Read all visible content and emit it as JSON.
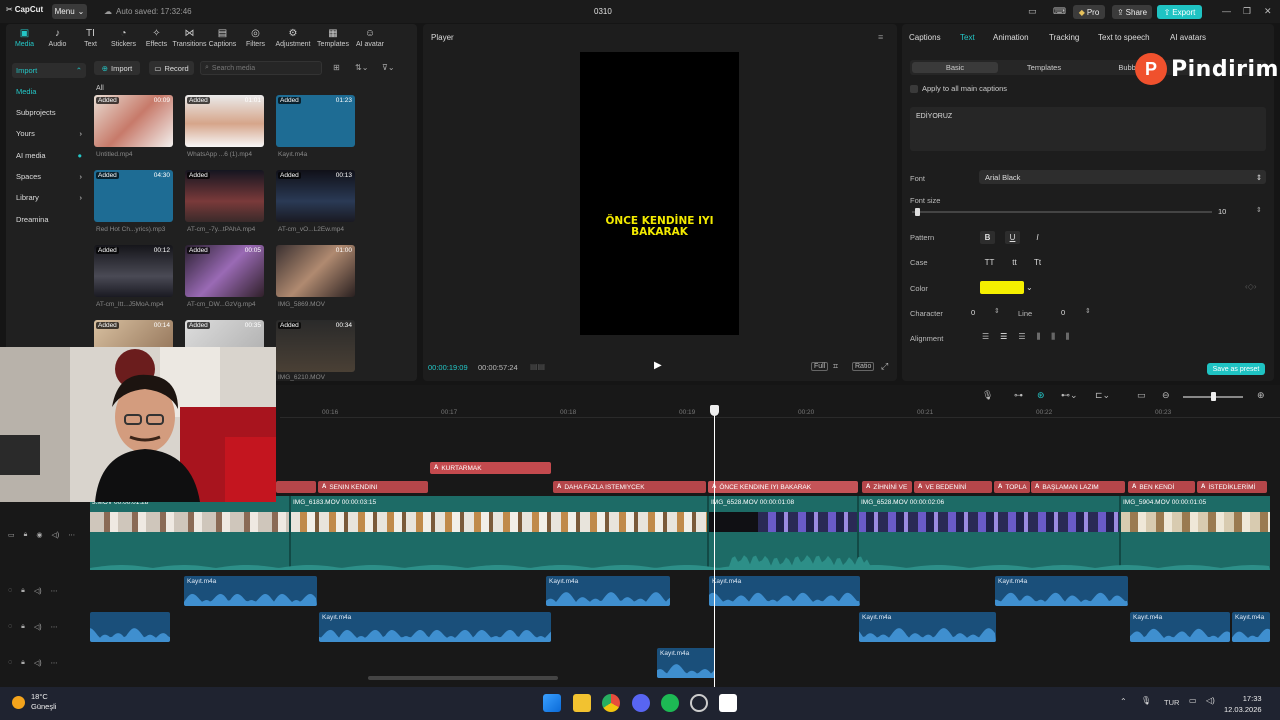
{
  "titlebar": {
    "app_name": "CapCut",
    "menu_label": "Menu",
    "autosave": "Auto saved: 17:32:46",
    "project_title": "0310",
    "pro_label": "Pro",
    "share_label": "Share",
    "export_label": "Export"
  },
  "toolbar": {
    "tools": [
      "Media",
      "Audio",
      "Text",
      "Stickers",
      "Effects",
      "Transitions",
      "Captions",
      "Filters",
      "Adjustment",
      "Templates",
      "AI avatar"
    ]
  },
  "sidebar": {
    "items": [
      "Import",
      "Media",
      "Subprojects",
      "Yours",
      "AI media",
      "Spaces",
      "Library",
      "Dreamina"
    ]
  },
  "media": {
    "import_label": "Import",
    "record_label": "Record",
    "search_placeholder": "Search media",
    "all_label": "All",
    "added_label": "Added",
    "items": [
      {
        "name": "Untitled.mp4",
        "duration": "00:09"
      },
      {
        "name": "WhatsApp ...6 (1).mp4",
        "duration": "01:01"
      },
      {
        "name": "Kayıt.m4a",
        "duration": "01:23"
      },
      {
        "name": "Red Hot Ch...yrics).mp3",
        "duration": "04:30"
      },
      {
        "name": "AT-cm_-7y...tPAhA.mp4",
        "duration": ""
      },
      {
        "name": "AT-cm_vO...L2Ew.mp4",
        "duration": "00:13"
      },
      {
        "name": "AT-cm_Itt...J5MoA.mp4",
        "duration": "00:12"
      },
      {
        "name": "AT-cm_DW...GzVg.mp4",
        "duration": "00:05"
      },
      {
        "name": "IMG_5869.MOV",
        "duration": "01:00"
      },
      {
        "name": "",
        "duration": "00:14"
      },
      {
        "name": "",
        "duration": "00:35"
      },
      {
        "name": "IMG_6210.MOV",
        "duration": "00:34"
      }
    ]
  },
  "player": {
    "title": "Player",
    "caption_line1": "ÖNCE KENDİNE IYI",
    "caption_line2": "BAKARAK",
    "current_time": "00:00:19:09",
    "total_time": "00:00:57:24",
    "full_label": "Full",
    "ratio_label": "Ratio"
  },
  "right_panel": {
    "tabs": [
      "Captions",
      "Text",
      "Animation",
      "Tracking",
      "Text to speech",
      "AI avatars"
    ],
    "subtabs": [
      "Basic",
      "Templates",
      "Bubble"
    ],
    "apply_all": "Apply to all main captions",
    "text_value": "EDİYORUZ",
    "font_label": "Font",
    "font_value": "Arial Black",
    "font_size_label": "Font size",
    "font_size_value": "10",
    "pattern_label": "Pattern",
    "case_label": "Case",
    "case_options": [
      "TT",
      "tt",
      "Tt"
    ],
    "color_label": "Color",
    "color_value": "#f5ef00",
    "character_label": "Character",
    "character_value": "0",
    "line_label": "Line",
    "line_value": "0",
    "alignment_label": "Alignment",
    "save_preset": "Save as preset"
  },
  "watermark": {
    "brand": "Pindirim",
    "logo_letter": "P"
  },
  "timeline": {
    "ruler": [
      "00:16",
      "00:17",
      "00:18",
      "00:19",
      "00:20",
      "00:21",
      "00:22",
      "00:23"
    ],
    "caption_clips_top": [
      "KURTARMAK"
    ],
    "caption_clips": [
      "SENIN KENDINI",
      "DAHA FAZLA ISTEMIYCEK",
      "ÖNCE KENDINE IYI BAKARAK",
      "ZİHNİNİ VE",
      "VE BEDENİNİ",
      "TOPLA",
      "BAŞLAMAN LAZIM",
      "BEN KENDİ",
      "İSTEDİKLERİMİ"
    ],
    "caption_tag": "A",
    "video_clips": [
      {
        "name": "3.MOV",
        "duration": "00:00:01:28"
      },
      {
        "name": "IMG_6183.MOV",
        "duration": "00:00:03:15"
      },
      {
        "name": "IMG_6528.MOV",
        "duration": "00:00:01:08"
      },
      {
        "name": "IMG_6528.MOV",
        "duration": "00:00:02:06"
      },
      {
        "name": "IMG_5904.MOV",
        "duration": "00:00:01:05"
      }
    ],
    "audio_label": "Kayıt.m4a"
  },
  "taskbar": {
    "temperature": "18°C",
    "weather": "Güneşli",
    "lang": "TUR",
    "time": "17:33",
    "date": "12.03.2026"
  }
}
